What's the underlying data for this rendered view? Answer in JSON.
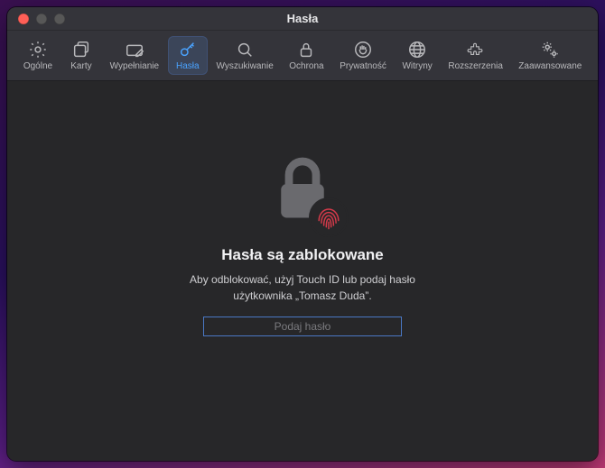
{
  "window": {
    "title": "Hasła"
  },
  "toolbar": {
    "tabs": [
      {
        "label": "Ogólne"
      },
      {
        "label": "Karty"
      },
      {
        "label": "Wypełnianie"
      },
      {
        "label": "Hasła"
      },
      {
        "label": "Wyszukiwanie"
      },
      {
        "label": "Ochrona"
      },
      {
        "label": "Prywatność"
      },
      {
        "label": "Witryny"
      },
      {
        "label": "Rozszerzenia"
      },
      {
        "label": "Zaawansowane"
      }
    ],
    "active_index": 3
  },
  "main": {
    "heading": "Hasła są zablokowane",
    "subtitle": "Aby odblokować, użyj Touch ID lub podaj hasło użytkownika „Tomasz Duda”.",
    "password_placeholder": "Podaj hasło",
    "password_value": ""
  },
  "colors": {
    "accent": "#4aa3ff",
    "focus_ring": "#4a78c4",
    "fingerprint": "#d63a4a"
  }
}
